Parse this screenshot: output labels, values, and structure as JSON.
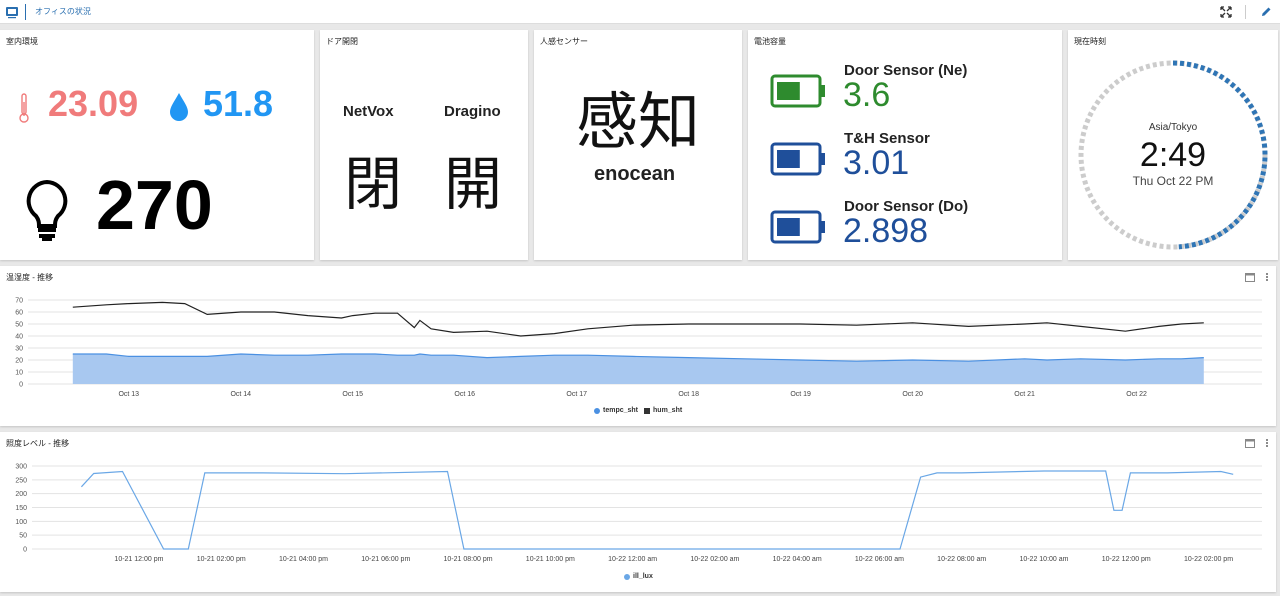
{
  "header": {
    "title": "オフィスの状況"
  },
  "cards": {
    "indoor": {
      "title": "室内環境",
      "temperature": "23.09",
      "humidity": "51.8",
      "illuminance": "270"
    },
    "door": {
      "title": "ドア開閉",
      "sensors": [
        {
          "name": "NetVox",
          "state": "閉"
        },
        {
          "name": "Dragino",
          "state": "開"
        }
      ]
    },
    "motion": {
      "title": "人感センサー",
      "state": "感知",
      "vendor": "enocean"
    },
    "battery": {
      "title": "電池容量",
      "items": [
        {
          "name": "Door Sensor (Ne)",
          "value": "3.6",
          "color": "#2e8b2e",
          "level": 0.6
        },
        {
          "name": "T&H Sensor",
          "value": "3.01",
          "color": "#1f4f9a",
          "level": 0.6
        },
        {
          "name": "Door Sensor (Do)",
          "value": "2.898",
          "color": "#1f4f9a",
          "level": 0.6
        }
      ]
    },
    "clock": {
      "title": "現在時刻",
      "timezone": "Asia/Tokyo",
      "time": "2:49",
      "date": "Thu Oct 22 PM",
      "progress": 0.49
    }
  },
  "colors": {
    "temp": "#f07b7b",
    "humidity": "#2196f3",
    "accent": "#2a6fb0"
  },
  "chart_data": [
    {
      "type": "area",
      "title": "温湿度 - 推移",
      "x_ticks": [
        "Oct 13",
        "Oct 14",
        "Oct 15",
        "Oct 16",
        "Oct 17",
        "Oct 18",
        "Oct 19",
        "Oct 20",
        "Oct 21",
        "Oct 22"
      ],
      "ylim": [
        0,
        70
      ],
      "y_ticks": [
        0,
        10,
        20,
        30,
        40,
        50,
        60,
        70
      ],
      "x": [
        12.5,
        12.8,
        13.0,
        13.3,
        13.5,
        13.7,
        14.0,
        14.3,
        14.6,
        14.9,
        15.0,
        15.2,
        15.4,
        15.55,
        15.6,
        15.7,
        15.9,
        16.2,
        16.5,
        16.8,
        17.1,
        17.5,
        18.0,
        18.5,
        19.0,
        19.5,
        20.0,
        20.5,
        21.0,
        21.2,
        21.5,
        21.9,
        22.2,
        22.4,
        22.6
      ],
      "series": [
        {
          "name": "tempc_sht",
          "color": "#4a90e2",
          "fill": "#a8c8f0",
          "values": [
            25,
            25,
            23,
            23,
            23,
            23,
            25,
            24,
            24,
            25,
            25,
            25,
            24,
            24,
            25,
            24,
            24,
            22,
            23,
            24,
            24,
            23,
            22,
            21,
            20,
            19,
            20,
            19,
            21,
            20,
            21,
            20,
            21,
            21,
            22
          ]
        },
        {
          "name": "hum_sht",
          "color": "#222222",
          "values": [
            64,
            66,
            67,
            68,
            67,
            58,
            60,
            60,
            57,
            55,
            57,
            59,
            59,
            47,
            53,
            46,
            43,
            44,
            40,
            42,
            46,
            49,
            50,
            50,
            50,
            49,
            51,
            48,
            50,
            51,
            48,
            44,
            48,
            50,
            51
          ]
        }
      ]
    },
    {
      "type": "line",
      "title": "照度レベル - 推移",
      "x_ticks": [
        "10-21 12:00 pm",
        "10-21 02:00 pm",
        "10-21 04:00 pm",
        "10-21 06:00 pm",
        "10-21 08:00 pm",
        "10-21 10:00 pm",
        "10-22 12:00 am",
        "10-22 02:00 am",
        "10-22 04:00 am",
        "10-22 06:00 am",
        "10-22 08:00 am",
        "10-22 10:00 am",
        "10-22 12:00 pm",
        "10-22 02:00 pm"
      ],
      "ylim": [
        0,
        300
      ],
      "y_ticks": [
        0,
        50,
        100,
        150,
        200,
        250,
        300
      ],
      "x": [
        -1.4,
        -1.1,
        -0.4,
        0.6,
        0.9,
        1.2,
        1.6,
        3,
        5,
        7.5,
        7.9,
        8.0,
        9,
        11,
        13,
        15,
        18.5,
        19.0,
        19.4,
        20,
        22,
        23.5,
        23.7,
        23.9,
        24.1,
        24.3,
        25,
        26.3,
        26.6
      ],
      "series": [
        {
          "name": "ill_lux",
          "color": "#6aa7e6",
          "values": [
            225,
            273,
            280,
            0,
            0,
            0,
            275,
            275,
            272,
            280,
            0,
            0,
            0,
            0,
            0,
            0,
            0,
            260,
            275,
            275,
            282,
            282,
            140,
            140,
            275,
            275,
            275,
            280,
            270
          ]
        }
      ]
    }
  ]
}
